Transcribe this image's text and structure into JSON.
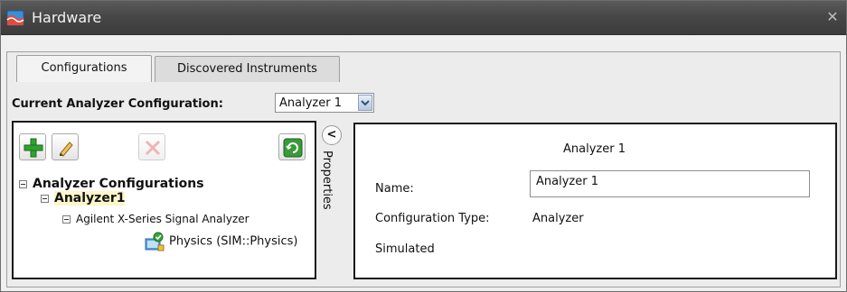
{
  "window": {
    "title": "Hardware",
    "close_glyph": "✕"
  },
  "tabs": [
    {
      "label": "Configurations",
      "active": true
    },
    {
      "label": "Discovered Instruments",
      "active": false
    }
  ],
  "current_config": {
    "label": "Current Analyzer Configuration:",
    "value": "Analyzer 1"
  },
  "toolbar": {
    "add_icon": "plus-icon",
    "edit_icon": "pencil-icon",
    "delete_icon": "delete-x-icon",
    "refresh_icon": "refresh-icon"
  },
  "tree": {
    "root": "Analyzer Configurations",
    "analyzer": "Analyzer1",
    "instrument": "Agilent X-Series Signal Analyzer",
    "physics": "Physics (SIM::Physics)"
  },
  "side_panel": {
    "toggle_glyph": "<",
    "label": "Properties"
  },
  "properties": {
    "header": "Analyzer 1",
    "name_label": "Name:",
    "name_value": "Analyzer 1",
    "type_label": "Configuration Type:",
    "type_value": "Analyzer",
    "simulated_label": "Simulated"
  },
  "colors": {
    "titlebar": "#474747",
    "add_green": "#2fa12f",
    "refresh_green": "#3a9a3a",
    "delete_red": "#e7a0a0"
  }
}
